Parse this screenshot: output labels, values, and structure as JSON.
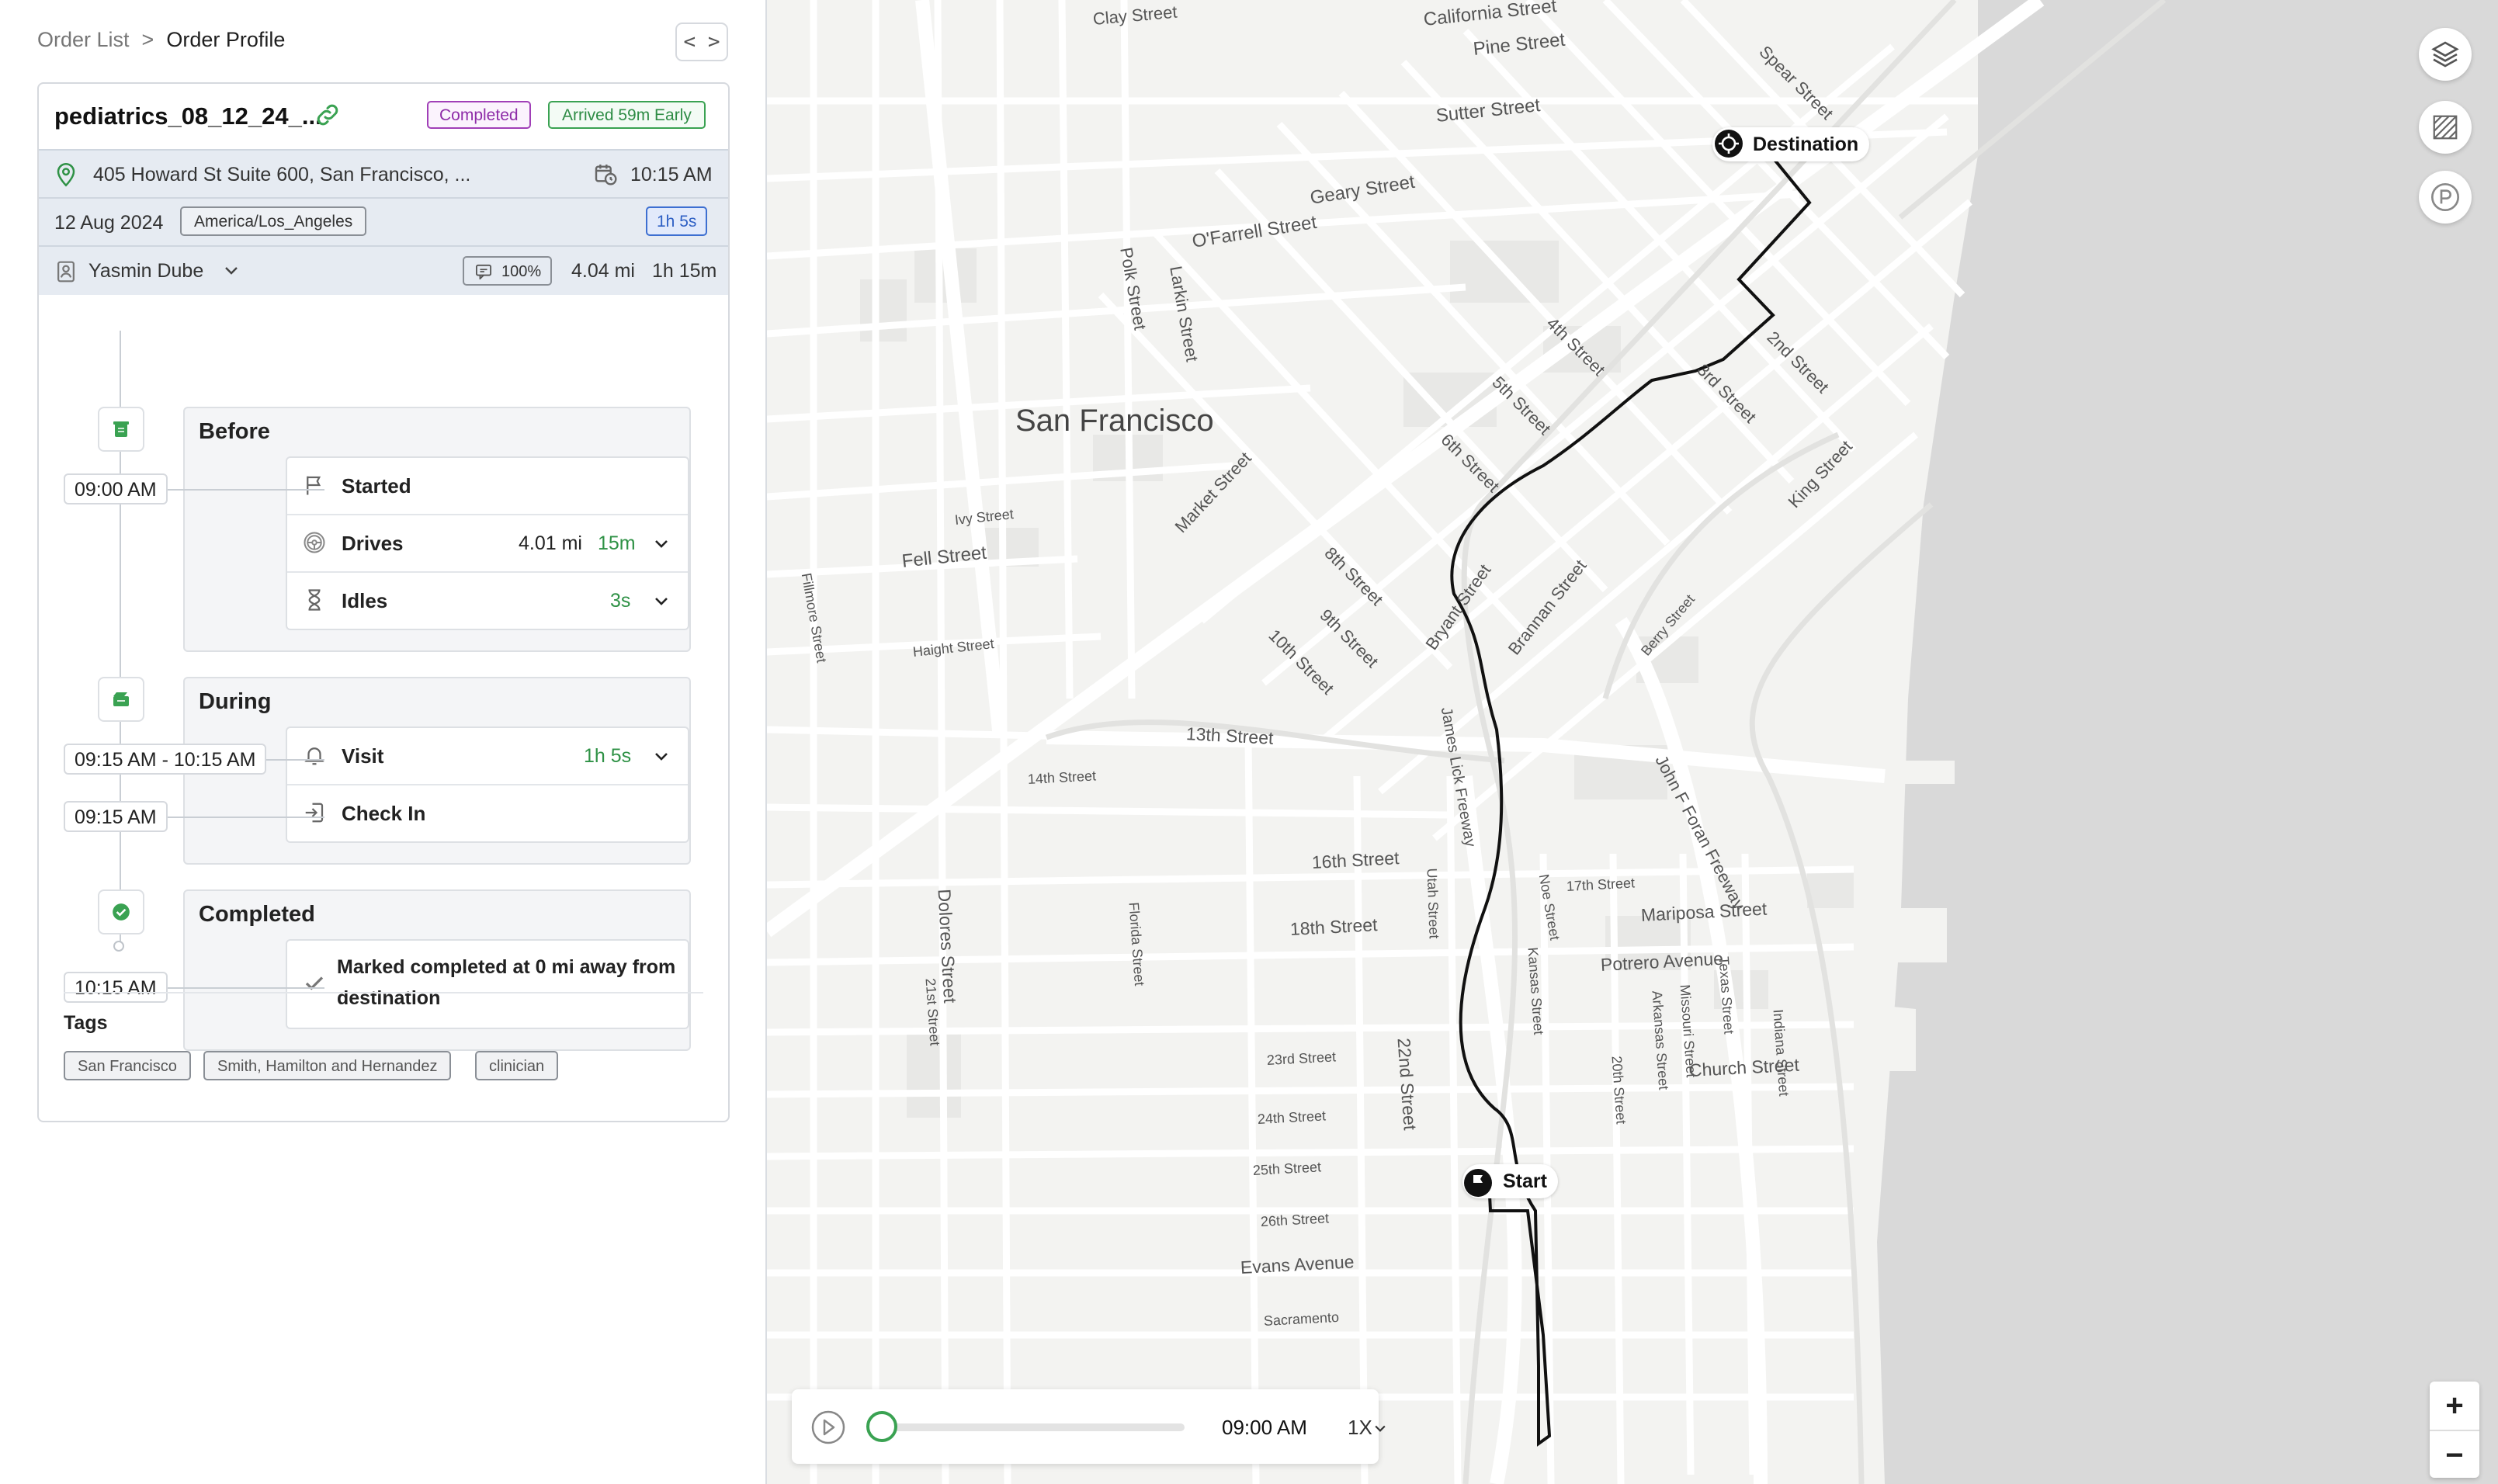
{
  "breadcrumb": {
    "parent": "Order List",
    "separator": ">",
    "current": "Order Profile"
  },
  "toolbar": {
    "code_toggle_label": "< >"
  },
  "order": {
    "title": "pediatrics_08_12_24_...",
    "status_badge": "Completed",
    "arrival_badge": "Arrived 59m Early",
    "address": "405 Howard St Suite 600, San Francisco, ...",
    "scheduled_time": "10:15 AM",
    "date": "12 Aug 2024",
    "timezone": "America/Los_Angeles",
    "visit_duration": "1h 5s",
    "assignee": "Yasmin Dube",
    "match_percent": "100%",
    "distance": "4.04 mi",
    "total_time": "1h 15m"
  },
  "timeline": {
    "before": {
      "title": "Before",
      "time": "09:00 AM",
      "items": [
        {
          "label": "Started"
        },
        {
          "label": "Drives",
          "distance": "4.01 mi",
          "duration": "15m"
        },
        {
          "label": "Idles",
          "duration": "3s"
        }
      ]
    },
    "during": {
      "title": "During",
      "visit_time": "09:15 AM - 10:15 AM",
      "checkin_time": "09:15 AM",
      "items": [
        {
          "label": "Visit",
          "duration": "1h 5s"
        },
        {
          "label": "Check In"
        }
      ]
    },
    "completed": {
      "title": "Completed",
      "time": "10:15 AM",
      "message": "Marked completed at 0 mi away from destination"
    }
  },
  "tags": {
    "heading": "Tags",
    "items": [
      "San Francisco",
      "Smith, Hamilton and Hernandez",
      "clinician"
    ]
  },
  "map": {
    "city_label": "San Francisco",
    "destination_label": "Destination",
    "start_label": "Start",
    "streets": [
      "Clay Street",
      "California Street",
      "Pine Street",
      "Sutter Street",
      "Spear Street",
      "Geary Street",
      "O'Farrell Street",
      "Polk Street",
      "Larkin Street",
      "Market Street",
      "4th Street",
      "5th Street",
      "2nd Street",
      "3rd Street",
      "6th Street",
      "King Street",
      "Ivy Street",
      "Fell Street",
      "Fillmore Street",
      "Haight Street",
      "8th Street",
      "9th Street",
      "10th Street",
      "Bryant Street",
      "Brannan Street",
      "Berry Street",
      "13th Street",
      "14th Street",
      "James Lick Freeway",
      "John F Foran Freeway",
      "16th Street",
      "Utah Street",
      "17th Street",
      "Mariposa Street",
      "Noe Street",
      "Dolores Street",
      "Florida Street",
      "18th Street",
      "Kansas Street",
      "Arkansas Street",
      "Missouri Street",
      "Texas Street",
      "Indiana Street",
      "Church Street",
      "Potrero Avenue",
      "20th Street",
      "21st Street",
      "22nd Street",
      "23rd Street",
      "24th Street",
      "25th Street",
      "26th Street",
      "Evans Avenue",
      "Sacramento"
    ],
    "controls": [
      "layers-icon",
      "hatch-icon",
      "parking-icon"
    ],
    "zoom_in": "+",
    "zoom_out": "−"
  },
  "player": {
    "time": "09:00 AM",
    "speed": "1X",
    "progress": 0
  }
}
